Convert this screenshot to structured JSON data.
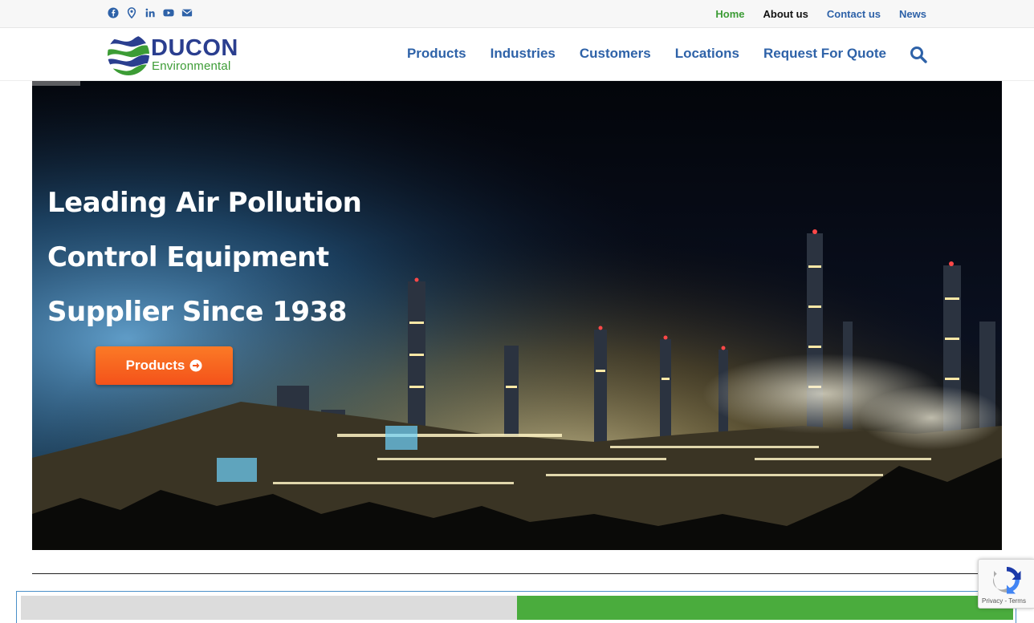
{
  "topbar": {
    "social_icons": [
      "facebook-icon",
      "map-marker-icon",
      "linkedin-icon",
      "youtube-icon",
      "envelope-icon"
    ],
    "links": [
      {
        "label": "Home",
        "color": "#3c9c35"
      },
      {
        "label": "About us",
        "color": "#111111"
      },
      {
        "label": "Contact us",
        "color": "#2e62a8"
      },
      {
        "label": "News",
        "color": "#2e62a8"
      }
    ]
  },
  "header": {
    "logo": {
      "word": "DUCON",
      "sub": "Environmental",
      "word_color": "#2a3e8f",
      "sub_color": "#3c9c35"
    },
    "nav": [
      "Products",
      "Industries",
      "Customers",
      "Locations",
      "Request For Quote"
    ],
    "nav_color": "#2e62a8",
    "search_icon": "search-icon"
  },
  "hero": {
    "title_lines": [
      "Leading Air Pollution",
      "Control Equipment",
      "Supplier Since 1938"
    ],
    "cta_label": "Products",
    "cta_icon": "arrow-circle-right-icon",
    "cta_color": "#f7621e"
  },
  "recaptcha": {
    "text": "Privacy - Terms"
  },
  "band": {
    "left_color": "#dcdcdc",
    "right_color": "#4aac3d"
  }
}
